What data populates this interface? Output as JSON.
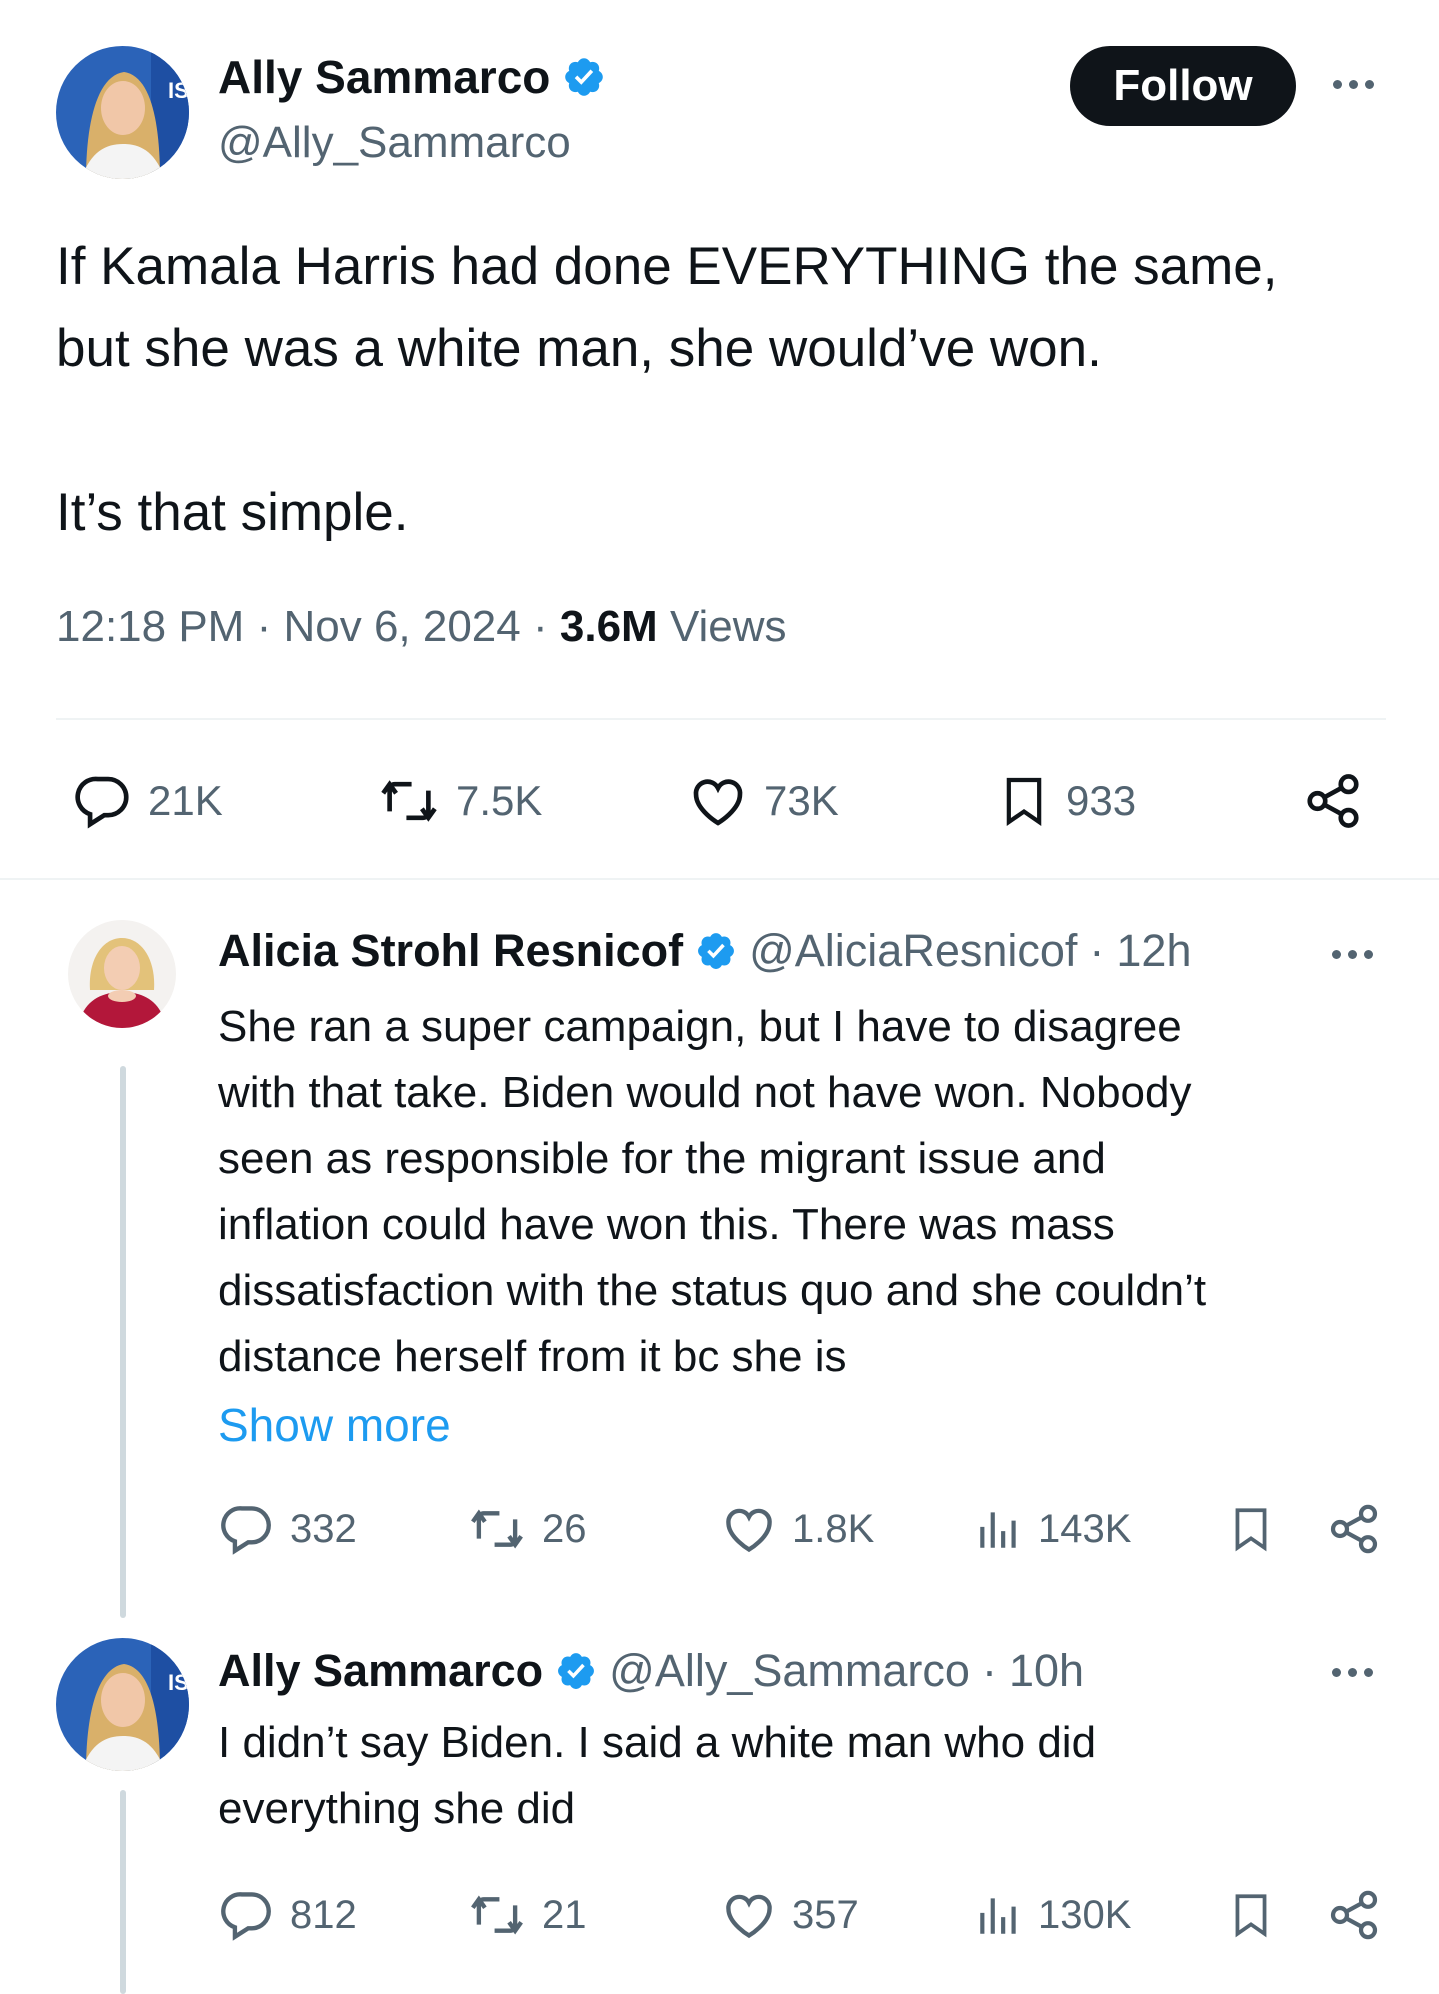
{
  "main_tweet": {
    "author_name": "Ally Sammarco",
    "handle": "@Ally_Sammarco",
    "follow_label": "Follow",
    "text": "If Kamala Harris had done EVERYTHING the same,\nbut she was a white man, she would’ve won.\n\nIt’s that simple.",
    "time": "12:18 PM",
    "date": "Nov 6, 2024",
    "views_count": "3.6M",
    "views_label": "Views",
    "sep": "·",
    "replies": "21K",
    "reposts": "7.5K",
    "likes": "73K",
    "bookmarks": "933",
    "avatar_badge": "IS"
  },
  "reply_1": {
    "author_name": "Alicia Strohl Resnicof",
    "handle": "@AliciaResnicof",
    "sep": "·",
    "age": "12h",
    "text_lines": [
      "She ran a super campaign, but I have to disagree",
      "with that take. Biden would not have won. Nobody",
      "seen as responsible for the migrant issue and",
      "inflation could have won this. There was mass",
      "dissatisfaction with the status quo and she couldn’t",
      "distance herself from it bc she is"
    ],
    "show_more": "Show more",
    "replies": "332",
    "reposts": "26",
    "likes": "1.8K",
    "views": "143K"
  },
  "reply_2": {
    "author_name": "Ally Sammarco",
    "handle": "@Ally_Sammarco",
    "sep": "·",
    "age": "10h",
    "text_lines": [
      "I didn’t say Biden. I said a white man who did",
      "everything she did"
    ],
    "replies": "812",
    "reposts": "21",
    "likes": "357",
    "views": "130K"
  },
  "colors": {
    "text": "#0f1419",
    "muted": "#536471",
    "link": "#1d9bf0",
    "verified": "#1d9bf0",
    "divider": "#eff3f4",
    "thread_line": "#cfd9de"
  },
  "icons": [
    "verified-badge-icon",
    "more-icon",
    "reply-icon",
    "repost-icon",
    "like-icon",
    "bookmark-icon",
    "share-icon",
    "views-icon"
  ]
}
